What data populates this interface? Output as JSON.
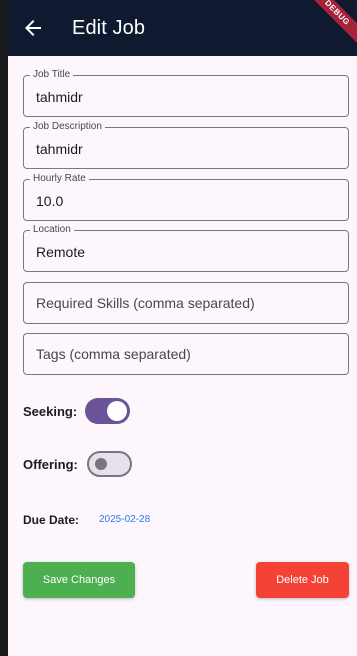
{
  "appbar": {
    "title": "Edit Job",
    "debug_badge": "DEBUG",
    "background": "#0f1a30"
  },
  "form": {
    "fields": [
      {
        "label": "Job Title",
        "value": "tahmidr"
      },
      {
        "label": "Job Description",
        "value": "tahmidr"
      },
      {
        "label": "Hourly Rate",
        "value": "10.0"
      },
      {
        "label": "Location",
        "value": "Remote"
      },
      {
        "placeholder": "Required Skills (comma separated)"
      },
      {
        "placeholder": "Tags (comma separated)"
      }
    ],
    "seeking": {
      "label": "Seeking:",
      "on": true
    },
    "offering": {
      "label": "Offering:",
      "on": false
    },
    "due_date": {
      "label": "Due Date:",
      "value": "2025-02-28"
    }
  },
  "actions": {
    "save_label": "Save Changes",
    "delete_label": "Delete Job",
    "save_color": "#4caf50",
    "delete_color": "#f44336"
  },
  "colors": {
    "accent": "#6a5396",
    "link": "#2c7be5"
  }
}
